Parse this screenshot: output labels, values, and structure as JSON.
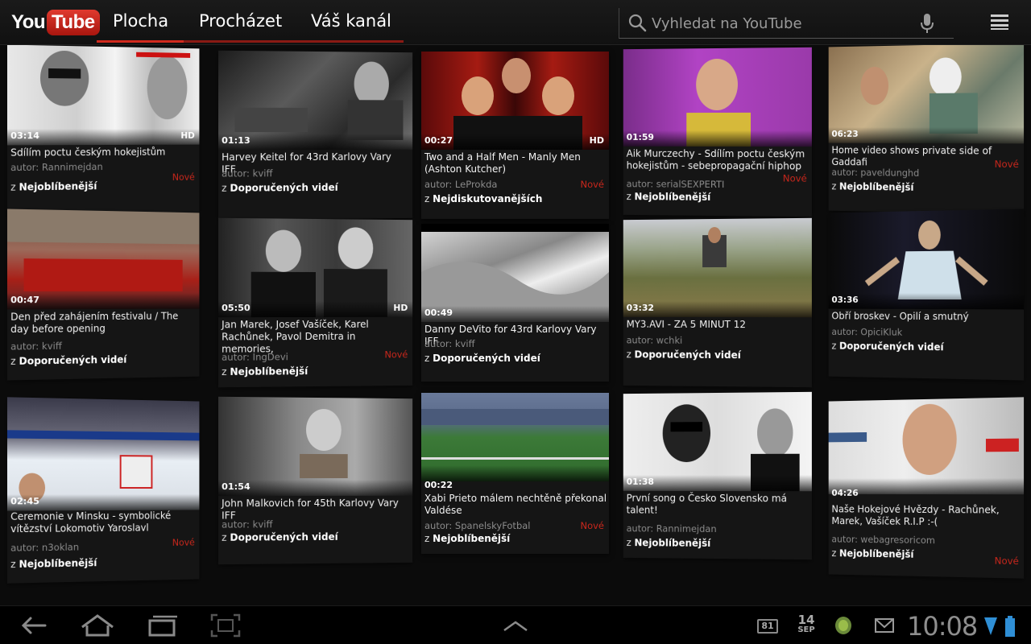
{
  "app": {
    "logo_you": "You",
    "logo_tube": "Tube"
  },
  "tabs": [
    {
      "label": "Plocha",
      "active": true
    },
    {
      "label": "Procházet",
      "active": false
    },
    {
      "label": "Váš kanál",
      "active": false
    }
  ],
  "search": {
    "placeholder": "Vyhledat na YouTube"
  },
  "videos": [
    {
      "duration": "03:14",
      "hd": "HD",
      "title": "Sdílím poctu českým hokejistům",
      "author": "autor: Rannimejdan",
      "new": "Nové",
      "source_prefix": "z",
      "source": "Nejoblíbenější"
    },
    {
      "duration": "01:13",
      "hd": "",
      "title": "Harvey Keitel for 43rd Karlovy Vary IFF",
      "author": "autor: kviff",
      "new": "",
      "source_prefix": "z",
      "source": "Doporučených videí"
    },
    {
      "duration": "00:27",
      "hd": "HD",
      "title": "Two and a Half Men - Manly Men (Ashton Kutcher)",
      "author": "autor: LeProkda",
      "new": "Nové",
      "source_prefix": "z",
      "source": "Nejdiskutovanějších"
    },
    {
      "duration": "01:59",
      "hd": "",
      "title": "Aik Murczechy - Sdílím poctu českým hokejistům - sebepropagační hiphop",
      "author": "autor: serialSEXPERTI",
      "new": "Nové",
      "source_prefix": "z",
      "source": "Nejoblíbenější"
    },
    {
      "duration": "06:23",
      "hd": "",
      "title": "Home video shows private side of Gaddafi",
      "author": "autor: paveldunghd",
      "new": "Nové",
      "source_prefix": "z",
      "source": "Nejoblíbenější"
    },
    {
      "duration": "00:47",
      "hd": "",
      "title": "Den před zahájením festivalu / The day before opening",
      "author": "autor: kviff",
      "new": "",
      "source_prefix": "z",
      "source": "Doporučených videí"
    },
    {
      "duration": "05:50",
      "hd": "HD",
      "title": "Jan Marek, Josef Vašíček, Karel Rachůnek, Pavol Demitra in memories,",
      "author": "autor: IngDevi",
      "new": "Nové",
      "source_prefix": "z",
      "source": "Nejoblíbenější"
    },
    {
      "duration": "00:49",
      "hd": "",
      "title": "Danny DeVito for 43rd Karlovy Vary IFF",
      "author": "autor: kviff",
      "new": "",
      "source_prefix": "z",
      "source": "Doporučených videí"
    },
    {
      "duration": "03:32",
      "hd": "",
      "title": "MY3.AVI - ZA 5 MINUT 12",
      "author": "autor: wchki",
      "new": "",
      "source_prefix": "z",
      "source": "Doporučených videí"
    },
    {
      "duration": "03:36",
      "hd": "",
      "title": "Obří broskev - Opilí a smutný",
      "author": "autor: OpiciKluk",
      "new": "",
      "source_prefix": "z",
      "source": "Doporučených videí"
    },
    {
      "duration": "02:45",
      "hd": "",
      "title": "Ceremonie v Minsku - symbolické vítězství Lokomotiv Yaroslavl",
      "author": "autor: n3oklan",
      "new": "Nové",
      "source_prefix": "z",
      "source": "Nejoblíbenější"
    },
    {
      "duration": "01:54",
      "hd": "",
      "title": "John Malkovich for 45th Karlovy Vary IFF",
      "author": "autor: kviff",
      "new": "",
      "source_prefix": "z",
      "source": "Doporučených videí"
    },
    {
      "duration": "00:22",
      "hd": "",
      "title": "Xabi Prieto málem nechtěně překonal Valdése",
      "author": "autor: SpanelskyFotbal",
      "new": "Nové",
      "source_prefix": "z",
      "source": "Nejoblíbenější"
    },
    {
      "duration": "01:38",
      "hd": "",
      "title": "První song o Česko Slovensko má talent!",
      "author": "autor: Rannimejdan",
      "new": "",
      "source_prefix": "z",
      "source": "Nejoblíbenější"
    },
    {
      "duration": "04:26",
      "hd": "",
      "title": "Naše Hokejové Hvězdy - Rachůnek, Marek, Vašíček R.I.P :-(",
      "author": "autor: webagresoricom",
      "new": "Nové",
      "source_prefix": "z",
      "source": "Nejoblíbenější"
    }
  ],
  "status": {
    "notification_count": "81",
    "date_day": "14",
    "date_month": "SEP",
    "time": "10:08"
  }
}
